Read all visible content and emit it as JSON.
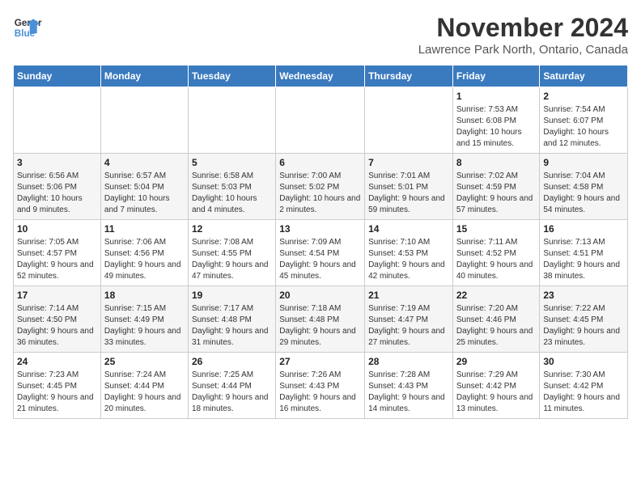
{
  "header": {
    "logo_line1": "General",
    "logo_line2": "Blue",
    "title": "November 2024",
    "subtitle": "Lawrence Park North, Ontario, Canada"
  },
  "weekdays": [
    "Sunday",
    "Monday",
    "Tuesday",
    "Wednesday",
    "Thursday",
    "Friday",
    "Saturday"
  ],
  "weeks": [
    [
      {
        "day": "",
        "info": ""
      },
      {
        "day": "",
        "info": ""
      },
      {
        "day": "",
        "info": ""
      },
      {
        "day": "",
        "info": ""
      },
      {
        "day": "",
        "info": ""
      },
      {
        "day": "1",
        "info": "Sunrise: 7:53 AM\nSunset: 6:08 PM\nDaylight: 10 hours and 15 minutes."
      },
      {
        "day": "2",
        "info": "Sunrise: 7:54 AM\nSunset: 6:07 PM\nDaylight: 10 hours and 12 minutes."
      }
    ],
    [
      {
        "day": "3",
        "info": "Sunrise: 6:56 AM\nSunset: 5:06 PM\nDaylight: 10 hours and 9 minutes."
      },
      {
        "day": "4",
        "info": "Sunrise: 6:57 AM\nSunset: 5:04 PM\nDaylight: 10 hours and 7 minutes."
      },
      {
        "day": "5",
        "info": "Sunrise: 6:58 AM\nSunset: 5:03 PM\nDaylight: 10 hours and 4 minutes."
      },
      {
        "day": "6",
        "info": "Sunrise: 7:00 AM\nSunset: 5:02 PM\nDaylight: 10 hours and 2 minutes."
      },
      {
        "day": "7",
        "info": "Sunrise: 7:01 AM\nSunset: 5:01 PM\nDaylight: 9 hours and 59 minutes."
      },
      {
        "day": "8",
        "info": "Sunrise: 7:02 AM\nSunset: 4:59 PM\nDaylight: 9 hours and 57 minutes."
      },
      {
        "day": "9",
        "info": "Sunrise: 7:04 AM\nSunset: 4:58 PM\nDaylight: 9 hours and 54 minutes."
      }
    ],
    [
      {
        "day": "10",
        "info": "Sunrise: 7:05 AM\nSunset: 4:57 PM\nDaylight: 9 hours and 52 minutes."
      },
      {
        "day": "11",
        "info": "Sunrise: 7:06 AM\nSunset: 4:56 PM\nDaylight: 9 hours and 49 minutes."
      },
      {
        "day": "12",
        "info": "Sunrise: 7:08 AM\nSunset: 4:55 PM\nDaylight: 9 hours and 47 minutes."
      },
      {
        "day": "13",
        "info": "Sunrise: 7:09 AM\nSunset: 4:54 PM\nDaylight: 9 hours and 45 minutes."
      },
      {
        "day": "14",
        "info": "Sunrise: 7:10 AM\nSunset: 4:53 PM\nDaylight: 9 hours and 42 minutes."
      },
      {
        "day": "15",
        "info": "Sunrise: 7:11 AM\nSunset: 4:52 PM\nDaylight: 9 hours and 40 minutes."
      },
      {
        "day": "16",
        "info": "Sunrise: 7:13 AM\nSunset: 4:51 PM\nDaylight: 9 hours and 38 minutes."
      }
    ],
    [
      {
        "day": "17",
        "info": "Sunrise: 7:14 AM\nSunset: 4:50 PM\nDaylight: 9 hours and 36 minutes."
      },
      {
        "day": "18",
        "info": "Sunrise: 7:15 AM\nSunset: 4:49 PM\nDaylight: 9 hours and 33 minutes."
      },
      {
        "day": "19",
        "info": "Sunrise: 7:17 AM\nSunset: 4:48 PM\nDaylight: 9 hours and 31 minutes."
      },
      {
        "day": "20",
        "info": "Sunrise: 7:18 AM\nSunset: 4:48 PM\nDaylight: 9 hours and 29 minutes."
      },
      {
        "day": "21",
        "info": "Sunrise: 7:19 AM\nSunset: 4:47 PM\nDaylight: 9 hours and 27 minutes."
      },
      {
        "day": "22",
        "info": "Sunrise: 7:20 AM\nSunset: 4:46 PM\nDaylight: 9 hours and 25 minutes."
      },
      {
        "day": "23",
        "info": "Sunrise: 7:22 AM\nSunset: 4:45 PM\nDaylight: 9 hours and 23 minutes."
      }
    ],
    [
      {
        "day": "24",
        "info": "Sunrise: 7:23 AM\nSunset: 4:45 PM\nDaylight: 9 hours and 21 minutes."
      },
      {
        "day": "25",
        "info": "Sunrise: 7:24 AM\nSunset: 4:44 PM\nDaylight: 9 hours and 20 minutes."
      },
      {
        "day": "26",
        "info": "Sunrise: 7:25 AM\nSunset: 4:44 PM\nDaylight: 9 hours and 18 minutes."
      },
      {
        "day": "27",
        "info": "Sunrise: 7:26 AM\nSunset: 4:43 PM\nDaylight: 9 hours and 16 minutes."
      },
      {
        "day": "28",
        "info": "Sunrise: 7:28 AM\nSunset: 4:43 PM\nDaylight: 9 hours and 14 minutes."
      },
      {
        "day": "29",
        "info": "Sunrise: 7:29 AM\nSunset: 4:42 PM\nDaylight: 9 hours and 13 minutes."
      },
      {
        "day": "30",
        "info": "Sunrise: 7:30 AM\nSunset: 4:42 PM\nDaylight: 9 hours and 11 minutes."
      }
    ]
  ]
}
